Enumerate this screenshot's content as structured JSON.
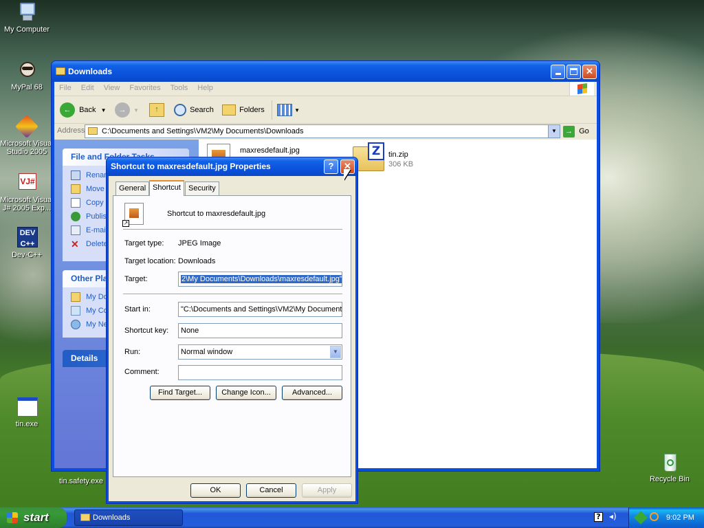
{
  "desktop": {
    "icons": [
      {
        "label": "My Computer"
      },
      {
        "label": "MyPal 68"
      },
      {
        "label": "Microsoft Visual Studio 2005"
      },
      {
        "label": "Microsoft Visual J# 2005 Exp..."
      },
      {
        "label": "Dev-C++"
      },
      {
        "label": "tin.exe"
      },
      {
        "label": "tin.safety.exe"
      },
      {
        "label": "Recycle Bin"
      }
    ]
  },
  "explorer": {
    "title": "Downloads",
    "menu": [
      "File",
      "Edit",
      "View",
      "Favorites",
      "Tools",
      "Help"
    ],
    "toolbar": {
      "back": "Back",
      "search": "Search",
      "folders": "Folders"
    },
    "address": {
      "label": "Address",
      "value": "C:\\Documents and Settings\\VM2\\My Documents\\Downloads",
      "go": "Go"
    },
    "tasks_panel": {
      "title": "File and Folder Tasks",
      "items": [
        "Rename this file",
        "Move this file",
        "Copy this file",
        "Publish this file to the Web",
        "E-mail this file",
        "Delete this file"
      ]
    },
    "other_places": {
      "title": "Other Places",
      "items": [
        "My Documents",
        "My Computer",
        "My Network Places"
      ]
    },
    "details": {
      "title": "Details"
    },
    "files": [
      {
        "name": "maxresdefault.jpg",
        "info": ""
      },
      {
        "name": "tin.zip",
        "info": "306 KB"
      }
    ]
  },
  "dialog": {
    "title": "Shortcut to maxresdefault.jpg Properties",
    "tabs": [
      "General",
      "Shortcut",
      "Security"
    ],
    "active_tab": "Shortcut",
    "name": "Shortcut to maxresdefault.jpg",
    "target_type_label": "Target type:",
    "target_type": "JPEG Image",
    "target_location_label": "Target location:",
    "target_location": "Downloads",
    "target_label": "Target:",
    "target": "2\\My Documents\\Downloads\\maxresdefault.jpg\"",
    "start_in_label": "Start in:",
    "start_in": "\"C:\\Documents and Settings\\VM2\\My Document",
    "shortcut_key_label": "Shortcut key:",
    "shortcut_key": "None",
    "run_label": "Run:",
    "run": "Normal window",
    "comment_label": "Comment:",
    "comment": "",
    "find_target": "Find Target...",
    "change_icon": "Change Icon...",
    "advanced": "Advanced...",
    "ok": "OK",
    "cancel": "Cancel",
    "apply": "Apply"
  },
  "taskbar": {
    "start": "start",
    "tasks": [
      "Downloads"
    ],
    "clock": "9:02 PM"
  },
  "colors": {
    "xp_blue": "#0a4de0",
    "start_green": "#379a37",
    "link_blue": "#215dc6",
    "selection": "#316ac5"
  }
}
